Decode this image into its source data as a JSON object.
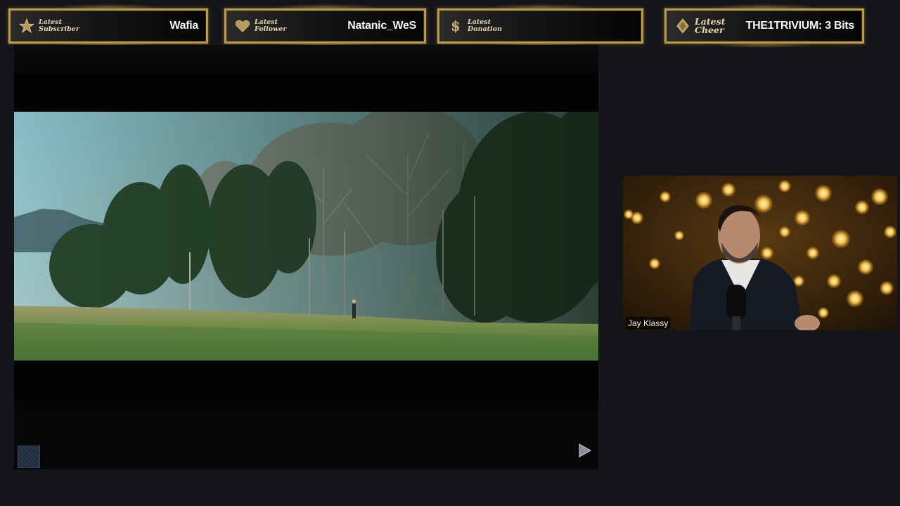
{
  "alerts": {
    "subscriber": {
      "label_line1": "Latest",
      "label_line2": "Subscriber",
      "value": "Wafia",
      "icon": "star-icon"
    },
    "follower": {
      "label_line1": "Latest",
      "label_line2": "Follower",
      "value": "Natanic_WeS",
      "icon": "heart-icon"
    },
    "donation": {
      "label_line1": "Latest",
      "label_line2": "Donation",
      "value": "",
      "icon": "dollar-icon"
    },
    "cheer": {
      "label_line1": "Latest",
      "label_line2": "Cheer",
      "value": "THE1TRIVIUM: 3 Bits",
      "icon": "diamond-icon"
    }
  },
  "webcam": {
    "name": "Jay Klassy"
  },
  "colors": {
    "gold": "#b89a4e",
    "label": "#e6d6ae",
    "background": "#14151a"
  }
}
